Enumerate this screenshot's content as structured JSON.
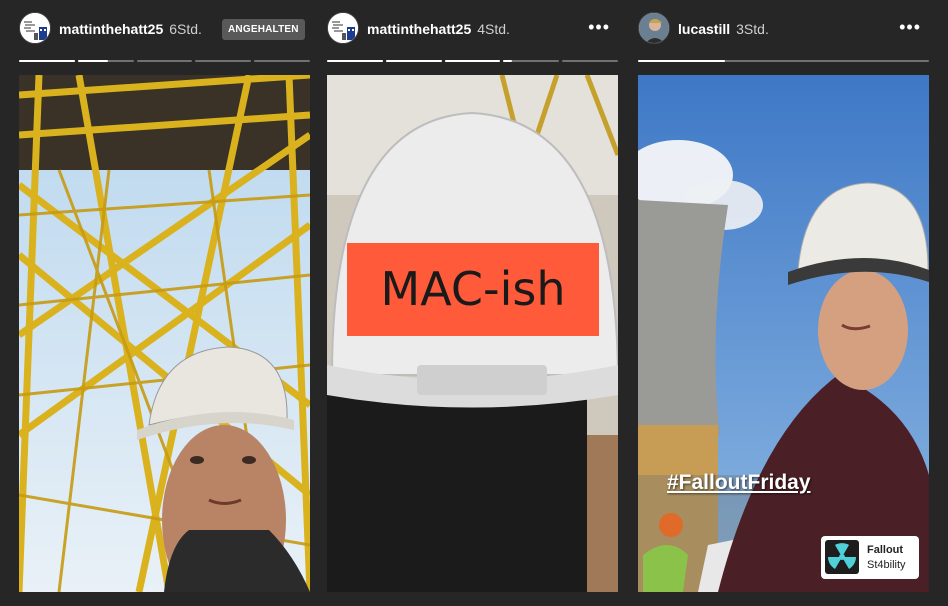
{
  "stories": [
    {
      "username": "mattinthehatt25",
      "time": "6Std.",
      "badge": "ANGEHALTEN",
      "avatar_icon": "avatar-doodle-icon",
      "progress": [
        1,
        0.55,
        0,
        0,
        0
      ]
    },
    {
      "username": "mattinthehatt25",
      "time": "4Std.",
      "more": "•••",
      "avatar_icon": "avatar-doodle-icon",
      "progress": [
        1,
        1,
        1,
        0.15,
        0
      ]
    },
    {
      "username": "lucastill",
      "time": "3Std.",
      "more": "•••",
      "avatar_icon": "avatar-person-icon",
      "progress": [
        0.3
      ]
    }
  ],
  "media": {
    "helmet_label": "MAC-ish",
    "hashtag": "#FalloutFriday",
    "sticker_line1": "Fallout",
    "sticker_line2": "St4bility"
  }
}
